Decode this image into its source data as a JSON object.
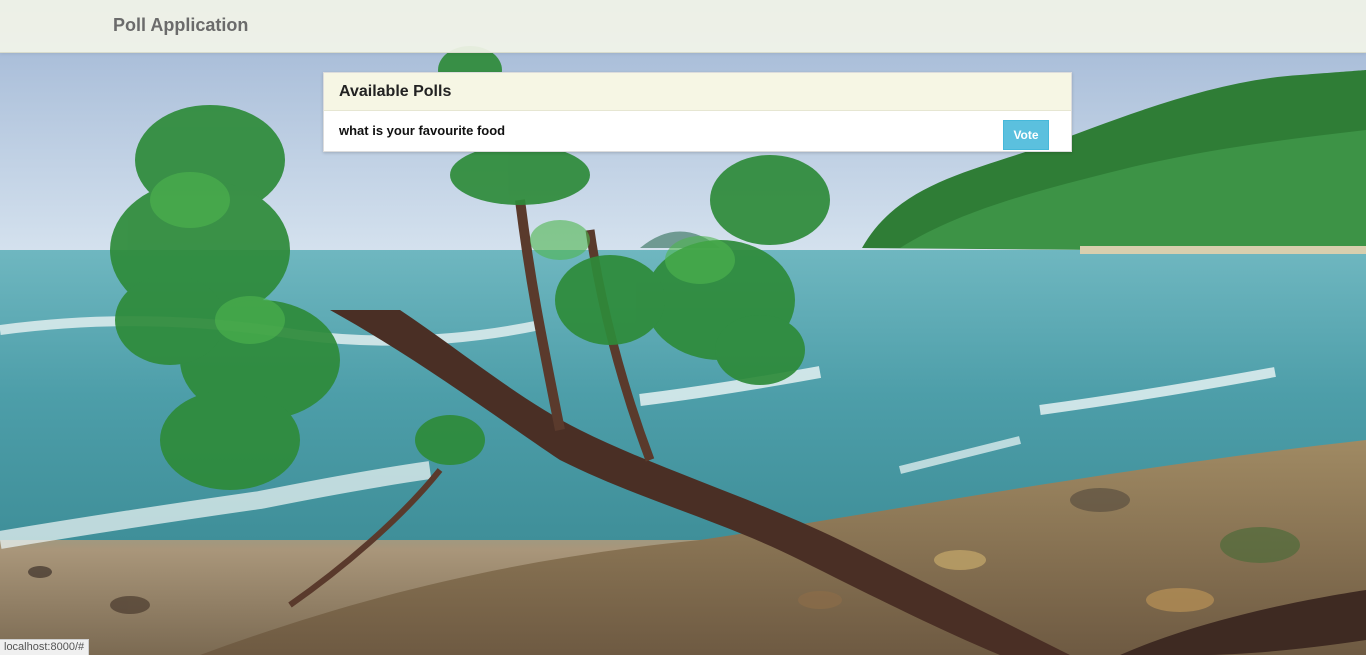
{
  "app": {
    "brand": "Poll Application"
  },
  "panel": {
    "title": "Available Polls",
    "polls": [
      {
        "question": "what is your favourite food",
        "vote_label": "Vote"
      }
    ]
  },
  "status_bar": {
    "url": "localhost:8000/#"
  },
  "background": {
    "description_icon": "beach-photo",
    "colors": {
      "sky": "#c6d7ea",
      "sea": "#4aa2ad",
      "foliage": "#2e8b3a",
      "rocks": "#8a7355",
      "trunk": "#4a2f25"
    }
  },
  "colors": {
    "navbar_bg": "#f2f4e8",
    "brand_text": "#6b6b6b",
    "panel_heading_bg": "#f6f6e4",
    "vote_button": "#5bc0de"
  }
}
